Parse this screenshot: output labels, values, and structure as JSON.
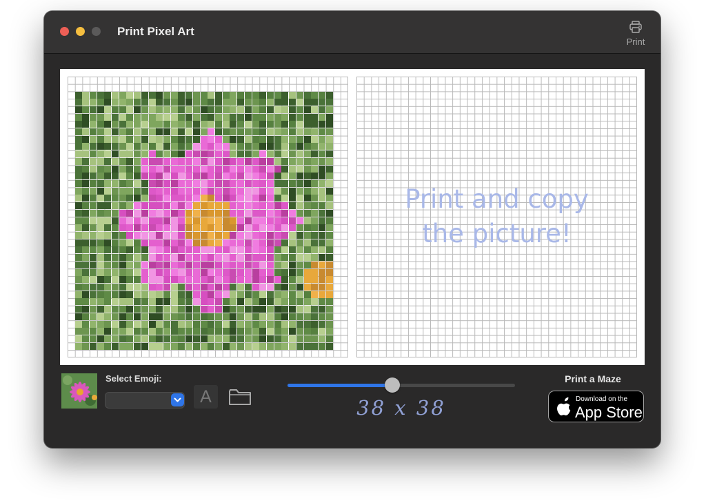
{
  "window": {
    "title": "Print Pixel Art",
    "traffic_lights": [
      "close",
      "minimize",
      "zoom"
    ]
  },
  "toolbar": {
    "print_label": "Print",
    "print_icon": "printer-icon"
  },
  "canvas": {
    "grid_cells": 38,
    "copy_prompt": [
      "Print and copy",
      "the picture!"
    ],
    "prompt_color": "#a9b8e8",
    "grid_line_color": "#b8b8b8"
  },
  "controls": {
    "select_emoji_label": "Select Emoji:",
    "emoji_selected": "",
    "text_button_label": "A",
    "folder_icon": "folder-icon",
    "slider_value": 0.46,
    "grid_size_label": "38 x 38",
    "accent_color": "#2f75e8"
  },
  "maze": {
    "title": "Print a Maze",
    "badge_small": "Download on the",
    "badge_large": "App Store",
    "badge_icon": "apple-icon"
  }
}
